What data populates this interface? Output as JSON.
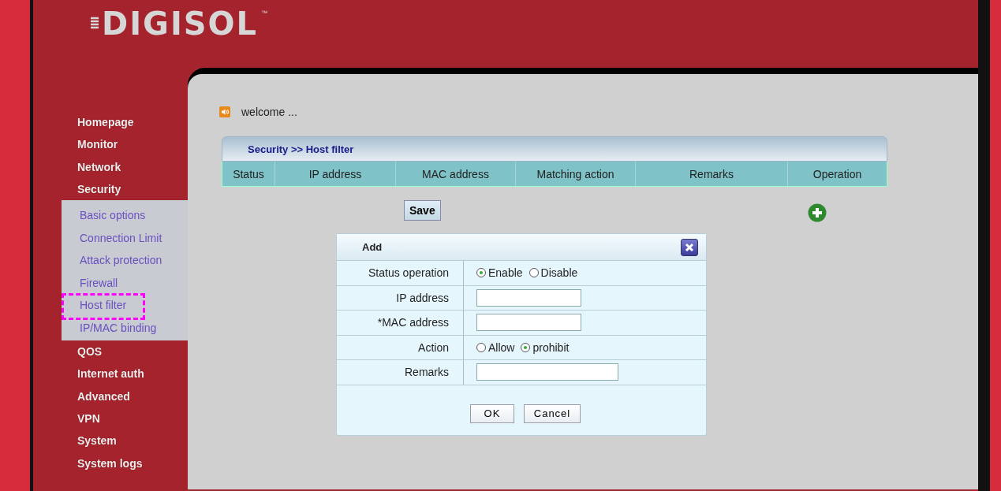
{
  "logo": {
    "text": "DIGISOL",
    "trademark": "™"
  },
  "sidebar": {
    "items": [
      {
        "label": "Homepage"
      },
      {
        "label": "Monitor"
      },
      {
        "label": "Network"
      },
      {
        "label": "Security",
        "expanded": true,
        "children": [
          {
            "label": "Basic options",
            "highlighted": false
          },
          {
            "label": "Connection Limit",
            "highlighted": false
          },
          {
            "label": "Attack protection",
            "highlighted": false
          },
          {
            "label": "Firewall",
            "highlighted": false
          },
          {
            "label": "Host filter",
            "highlighted": true
          },
          {
            "label": "IP/MAC binding",
            "highlighted": false
          }
        ]
      },
      {
        "label": "QOS"
      },
      {
        "label": "Internet auth"
      },
      {
        "label": "Advanced"
      },
      {
        "label": "VPN"
      },
      {
        "label": "System"
      },
      {
        "label": "System logs"
      }
    ]
  },
  "welcome": "welcome ...",
  "panel": {
    "title": "Security >> Host filter",
    "columns": [
      "Status",
      "IP address",
      "MAC address",
      "Matching action",
      "Remarks",
      "Operation"
    ],
    "save_button": "Save"
  },
  "dialog": {
    "title": "Add",
    "rows": [
      {
        "kind": "radio",
        "label": "Status operation",
        "options": [
          {
            "label": "Enable",
            "selected": true
          },
          {
            "label": "Disable",
            "selected": false
          }
        ]
      },
      {
        "kind": "input",
        "label": "IP address"
      },
      {
        "kind": "input",
        "label": "*MAC address"
      },
      {
        "kind": "radio",
        "label": "Action",
        "options": [
          {
            "label": "Allow",
            "selected": false
          },
          {
            "label": "prohibit",
            "selected": true
          }
        ]
      },
      {
        "kind": "input",
        "label": "Remarks"
      }
    ],
    "buttons": [
      "OK",
      "Cancel"
    ]
  }
}
